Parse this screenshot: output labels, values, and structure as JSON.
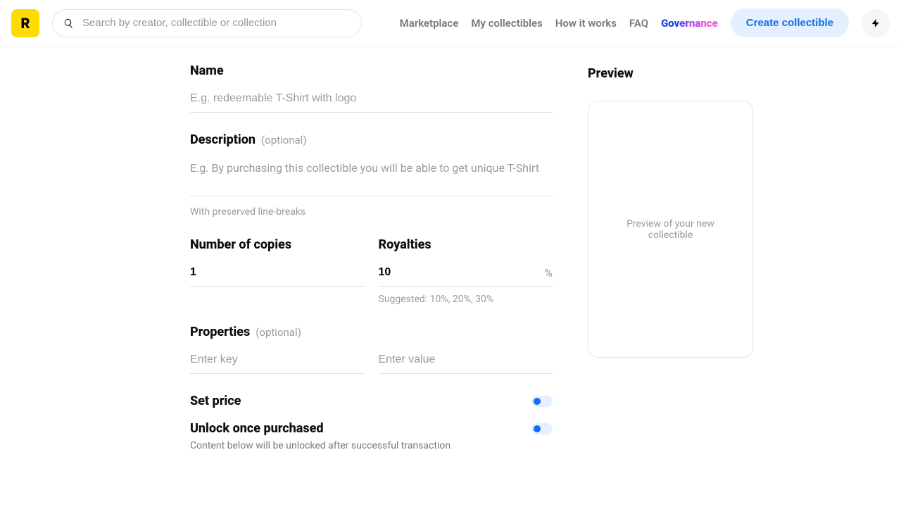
{
  "header": {
    "logo_letter": "R",
    "search_placeholder": "Search by creator, collectible or collection",
    "nav": {
      "marketplace": "Marketplace",
      "my_collectibles": "My collectibles",
      "how_it_works": "How it works",
      "faq": "FAQ",
      "governance_parts": {
        "a": "Gov",
        "b": "er",
        "c": "na",
        "d": "nce"
      }
    },
    "create_button": "Create collectible"
  },
  "form": {
    "name": {
      "label": "Name",
      "placeholder": "E.g. redeemable T-Shirt with logo",
      "value": ""
    },
    "description": {
      "label": "Description",
      "optional": "(optional)",
      "placeholder": "E.g. By purchasing this collectible you will be able to get unique T-Shirt",
      "value": "",
      "hint": "With preserved line-breaks"
    },
    "copies": {
      "label": "Number of copies",
      "value": "1"
    },
    "royalties": {
      "label": "Royalties",
      "value": "10",
      "suffix": "%",
      "hint": "Suggested: 10%, 20%, 30%"
    },
    "properties": {
      "label": "Properties",
      "optional": "(optional)",
      "key_placeholder": "Enter key",
      "value_placeholder": "Enter value"
    },
    "set_price": {
      "label": "Set price"
    },
    "unlock": {
      "label": "Unlock once purchased",
      "sub": "Content below will be unlocked after successful transaction"
    }
  },
  "preview": {
    "title": "Preview",
    "placeholder": "Preview of your new collectible"
  }
}
